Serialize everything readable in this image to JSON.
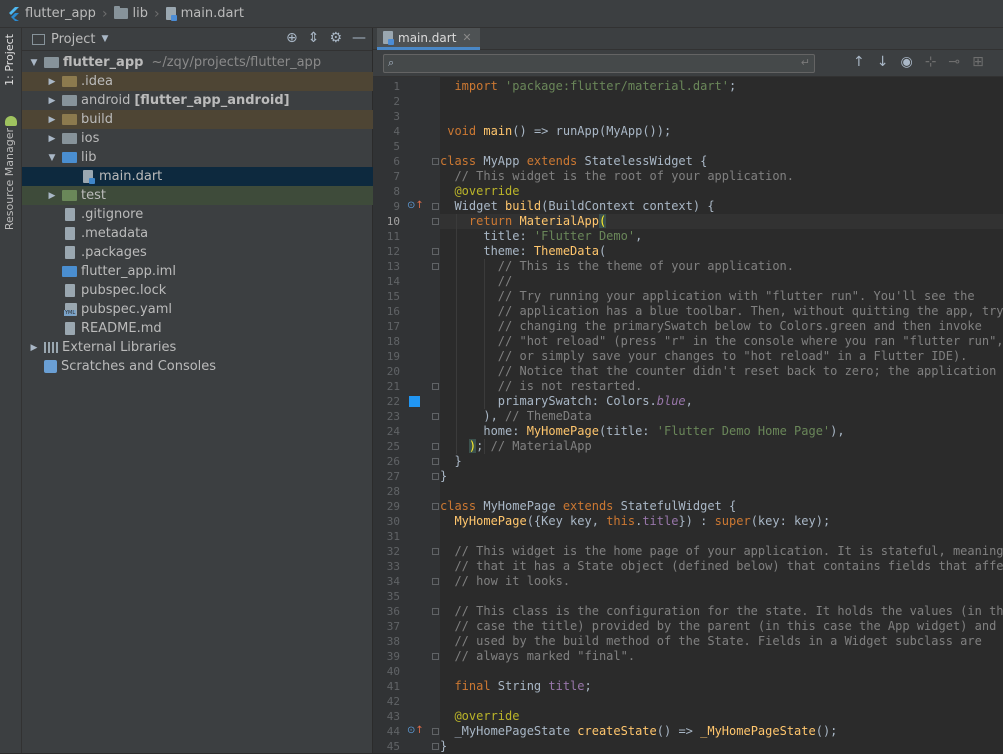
{
  "breadcrumb": [
    "flutter_app",
    "lib",
    "main.dart"
  ],
  "left_strip": {
    "project_tab": "1: Project",
    "resource_tab": "Resource Manager"
  },
  "project_panel": {
    "title": "Project",
    "tree": [
      {
        "label": "flutter_app",
        "extra": "~/zqy/projects/flutter_app",
        "level": 0,
        "arrow": "down",
        "icon": "folder",
        "bold": true
      },
      {
        "label": ".idea",
        "level": 1,
        "arrow": "right",
        "icon": "folder",
        "color": "orange"
      },
      {
        "label": "android",
        "extra": "[flutter_app_android]",
        "level": 1,
        "arrow": "right",
        "icon": "folder"
      },
      {
        "label": "build",
        "level": 1,
        "arrow": "right",
        "icon": "folder",
        "color": "orange"
      },
      {
        "label": "ios",
        "level": 1,
        "arrow": "right",
        "icon": "folder"
      },
      {
        "label": "lib",
        "level": 1,
        "arrow": "down",
        "icon": "folder"
      },
      {
        "label": "main.dart",
        "level": 2,
        "arrow": "",
        "icon": "dart",
        "selected": true
      },
      {
        "label": "test",
        "level": 1,
        "arrow": "right",
        "icon": "folder",
        "color": "green"
      },
      {
        "label": ".gitignore",
        "level": 1,
        "arrow": "",
        "icon": "doc"
      },
      {
        "label": ".metadata",
        "level": 1,
        "arrow": "",
        "icon": "doc"
      },
      {
        "label": ".packages",
        "level": 1,
        "arrow": "",
        "icon": "doc"
      },
      {
        "label": "flutter_app.iml",
        "level": 1,
        "arrow": "",
        "icon": "folder"
      },
      {
        "label": "pubspec.lock",
        "level": 1,
        "arrow": "",
        "icon": "doc"
      },
      {
        "label": "pubspec.yaml",
        "level": 1,
        "arrow": "",
        "icon": "yaml"
      },
      {
        "label": "README.md",
        "level": 1,
        "arrow": "",
        "icon": "doc"
      },
      {
        "label": "External Libraries",
        "level": 0,
        "arrow": "right",
        "icon": "libs"
      },
      {
        "label": "Scratches and Consoles",
        "level": 0,
        "arrow": "",
        "icon": "scratch"
      }
    ]
  },
  "editor": {
    "tab": "main.dart",
    "search_placeholder": "",
    "lines": [
      "  import 'package:flutter/material.dart';",
      "",
      "",
      " void main() => runApp(MyApp());",
      "",
      "class MyApp extends StatelessWidget {",
      "  // This widget is the root of your application.",
      "  @override",
      "  Widget build(BuildContext context) {",
      "    return MaterialApp(",
      "      title: 'Flutter Demo',",
      "      theme: ThemeData(",
      "        // This is the theme of your application.",
      "        //",
      "        // Try running your application with \"flutter run\". You'll see the",
      "        // application has a blue toolbar. Then, without quitting the app, try",
      "        // changing the primarySwatch below to Colors.green and then invoke",
      "        // \"hot reload\" (press \"r\" in the console where you ran \"flutter run\",",
      "        // or simply save your changes to \"hot reload\" in a Flutter IDE).",
      "        // Notice that the counter didn't reset back to zero; the application",
      "        // is not restarted.",
      "        primarySwatch: Colors.blue,",
      "      ), // ThemeData",
      "      home: MyHomePage(title: 'Flutter Demo Home Page'),",
      "    ); // MaterialApp",
      "  }",
      "}",
      "",
      "class MyHomePage extends StatefulWidget {",
      "  MyHomePage({Key key, this.title}) : super(key: key);",
      "",
      "  // This widget is the home page of your application. It is stateful, meaning",
      "  // that it has a State object (defined below) that contains fields that affect",
      "  // how it looks.",
      "",
      "  // This class is the configuration for the state. It holds the values (in this",
      "  // case the title) provided by the parent (in this case the App widget) and",
      "  // used by the build method of the State. Fields in a Widget subclass are",
      "  // always marked \"final\".",
      "",
      "  final String title;",
      "",
      "  @override",
      "  _MyHomePageState createState() => _MyHomePageState();",
      "}"
    ],
    "current_line": 10,
    "color_swatch": "#2196f3"
  }
}
